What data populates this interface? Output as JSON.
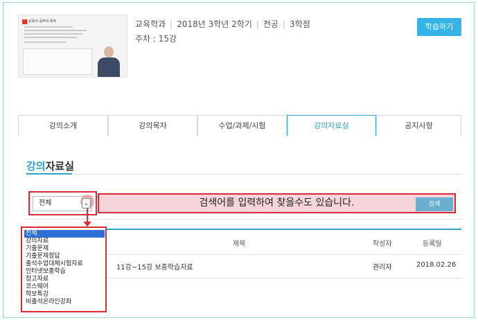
{
  "header": {
    "lecture_thumbnail": {
      "title": "교육사 공부의 목적"
    },
    "department": "교육학과",
    "term": "2018년 3학년 2학기",
    "category": "전공",
    "credits": "3학점",
    "week": "주차 : 15강",
    "study_button": "학습하기"
  },
  "tabs": [
    {
      "label": "강의소개",
      "active": false
    },
    {
      "label": "강의목차",
      "active": false
    },
    {
      "label": "수업/과제/시험",
      "active": false
    },
    {
      "label": "강의자료실",
      "active": true
    },
    {
      "label": "공지사항",
      "active": false
    }
  ],
  "section": {
    "title_accent": "강의",
    "title_rest": "자료실"
  },
  "search": {
    "selected_option": "전체",
    "hint": "검색어를 입력하여 찾을수도 있습니다.",
    "button": "검색"
  },
  "table": {
    "headers": {
      "title": "제목",
      "author": "작성자",
      "date": "등록일"
    },
    "rows": [
      {
        "title": "11강~15강 보충학습자료",
        "author": "관리자",
        "date": "2018.02.26"
      }
    ]
  },
  "dropdown_options": [
    "전체",
    "강의자료",
    "기출문제",
    "기출문제정답",
    "출석수업대체시험자료",
    "인터넷보충학습",
    "참고자료",
    "코스웨어",
    "학보특강",
    "비출석온라인강좌"
  ],
  "colors": {
    "accent": "#2fa3c8",
    "button": "#38b3e8",
    "highlight_border": "#d92a3a",
    "highlight_fill": "#f6d5da",
    "dropdown_selected": "#2f6fd6"
  }
}
